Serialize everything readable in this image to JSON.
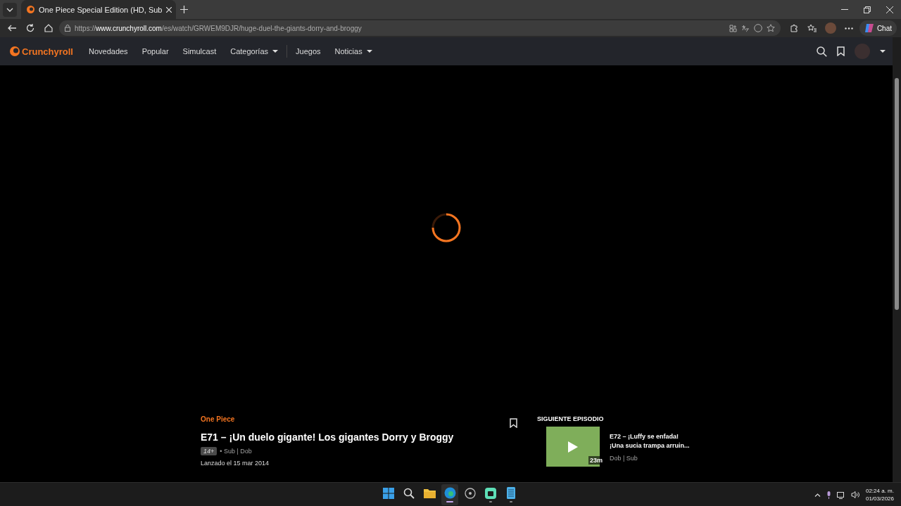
{
  "browser": {
    "tab_title": "One Piece Special Edition (HD, Sub",
    "url_scheme": "https://",
    "url_host": "www.crunchyroll.com",
    "url_path": "/es/watch/GRWEM9DJR/huge-duel-the-giants-dorry-and-broggy",
    "chat_label": "Chat"
  },
  "site_nav": {
    "logo": "Crunchyroll",
    "items": [
      {
        "label": "Novedades",
        "dropdown": false
      },
      {
        "label": "Popular",
        "dropdown": false
      },
      {
        "label": "Simulcast",
        "dropdown": false
      },
      {
        "label": "Categorías",
        "dropdown": true
      },
      {
        "label": "Juegos",
        "dropdown": false
      },
      {
        "label": "Noticias",
        "dropdown": true
      }
    ]
  },
  "episode": {
    "series": "One Piece",
    "title": "E71 – ¡Un duelo gigante! Los gigantes Dorry y Broggy",
    "rating": "14+",
    "languages": "• Sub | Dob",
    "release": "Lanzado el 15 mar 2014"
  },
  "next_episode": {
    "heading": "SIGUIENTE EPISODIO",
    "title_line_1": "E72 – ¡Luffy se enfada!",
    "title_line_2": "¡Una sucia trampa arruin...",
    "duration": "23m",
    "languages": "Dob | Sub"
  },
  "taskbar": {
    "apps": [
      {
        "kind": "start",
        "selected": false,
        "open": false
      },
      {
        "kind": "search",
        "selected": false,
        "open": false
      },
      {
        "kind": "files",
        "selected": false,
        "open": false
      },
      {
        "kind": "edge",
        "selected": true,
        "open": true
      },
      {
        "kind": "obs",
        "selected": false,
        "open": false
      },
      {
        "kind": "chat",
        "selected": false,
        "open": true
      },
      {
        "kind": "notepad",
        "selected": false,
        "open": true
      }
    ],
    "time": "02:24 a. m.",
    "date": "01/03/2026"
  }
}
